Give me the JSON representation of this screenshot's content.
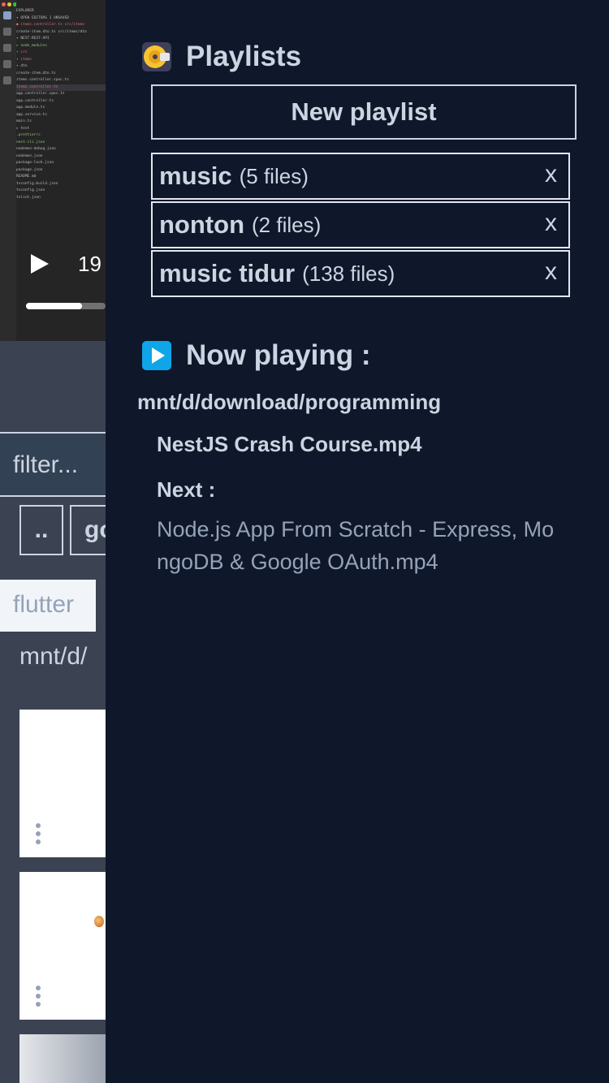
{
  "background_app": {
    "explorer_lines": [
      {
        "text": "EXPLORER",
        "cls": ""
      },
      {
        "text": "▾ OPEN EDITORS  1 UNSAVED",
        "cls": ""
      },
      {
        "text": "  ● items.controller.ts  src/items",
        "cls": "red"
      },
      {
        "text": "    create-item.dto.ts  src/items/dto",
        "cls": ""
      },
      {
        "text": "▾ NEST-REST-API",
        "cls": ""
      },
      {
        "text": "  ▸ node_modules",
        "cls": "grn"
      },
      {
        "text": "  ▾ src",
        "cls": "red"
      },
      {
        "text": "    ▾ items",
        "cls": "red"
      },
      {
        "text": "      ▾ dto",
        "cls": ""
      },
      {
        "text": "        create-item.dto.ts",
        "cls": ""
      },
      {
        "text": "      items.controller.spec.ts",
        "cls": ""
      },
      {
        "text": "      items.controller.ts",
        "cls": "red hl"
      },
      {
        "text": "    app.controller.spec.ts",
        "cls": ""
      },
      {
        "text": "    app.controller.ts",
        "cls": ""
      },
      {
        "text": "    app.module.ts",
        "cls": ""
      },
      {
        "text": "    app.service.ts",
        "cls": ""
      },
      {
        "text": "    main.ts",
        "cls": ""
      },
      {
        "text": "  ▸ test",
        "cls": ""
      },
      {
        "text": "  .prettierrc",
        "cls": "grn"
      },
      {
        "text": "  nest-cli.json",
        "cls": "grn"
      },
      {
        "text": "  nodemon-debug.json",
        "cls": ""
      },
      {
        "text": "  nodemon.json",
        "cls": ""
      },
      {
        "text": "  package-lock.json",
        "cls": ""
      },
      {
        "text": "  package.json",
        "cls": ""
      },
      {
        "text": "  README.md",
        "cls": ""
      },
      {
        "text": "  tsconfig.build.json",
        "cls": ""
      },
      {
        "text": "  tsconfig.json",
        "cls": ""
      },
      {
        "text": "  tslint.json",
        "cls": ""
      }
    ],
    "video": {
      "time": "19",
      "progress": 0.7
    },
    "filter_placeholder": "filter...",
    "dir_buttons": [
      "..",
      "go"
    ],
    "chip_label": "flutter",
    "path": "mnt/d/"
  },
  "playlists": {
    "title": "Playlists",
    "icon": "disc-icon",
    "new_button": "New playlist",
    "items": [
      {
        "name": "music",
        "count": "(5 files)",
        "close": "x"
      },
      {
        "name": "nonton",
        "count": "(2 files)",
        "close": "x"
      },
      {
        "name": "music tidur",
        "count": "(138 files)",
        "close": "x"
      }
    ]
  },
  "now_playing": {
    "title": "Now playing :",
    "icon": "play-icon",
    "directory": "mnt/d/download/programming",
    "current_file": "NestJS Crash Course.mp4",
    "next_label": "Next :",
    "next_file": "Node.js App From Scratch - Express, MongoDB & Google OAuth.mp4"
  },
  "colors": {
    "panel_bg": "#0f172a",
    "text": "#cbd5e1",
    "muted": "#94a3b8",
    "play_icon": "#0ea5e9",
    "disc": "#f6c431"
  }
}
